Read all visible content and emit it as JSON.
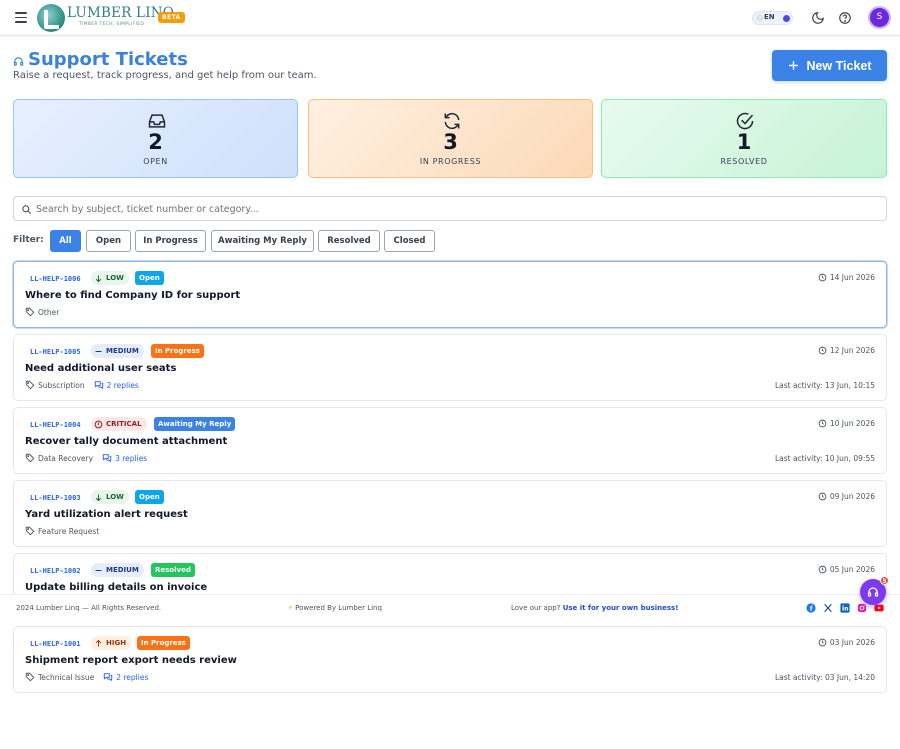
{
  "app": {
    "logo_text": "LUMBER LINQ",
    "logo_tagline": "TIMBER TECH, SIMPLIFIED",
    "beta_label": "BETA",
    "language": "EN",
    "avatar_initial": "S"
  },
  "header": {
    "title": "Support Tickets",
    "subtitle": "Raise a request, track progress, and get help from our team.",
    "new_ticket_label": "New Ticket"
  },
  "stats": [
    {
      "count": "2",
      "label": "OPEN",
      "icon": "inbox-icon",
      "color": "#3b82f6"
    },
    {
      "count": "3",
      "label": "IN PROGRESS",
      "icon": "refresh-icon",
      "color": "#f97316"
    },
    {
      "count": "1",
      "label": "RESOLVED",
      "icon": "check-circle-icon",
      "color": "#22c55e"
    }
  ],
  "search": {
    "placeholder": "Search by subject, ticket number or category..."
  },
  "filters": {
    "label": "Filter:",
    "options": [
      "All",
      "Open",
      "In Progress",
      "Awaiting My Reply",
      "Resolved",
      "Closed"
    ],
    "active": "All"
  },
  "tickets": [
    {
      "id": "LL-HELP-1006",
      "priority": "LOW",
      "status": "Open",
      "date": "14 Jun 2026",
      "subject": "Where to find Company ID for support",
      "category": "Other",
      "replies": "",
      "last_activity": ""
    },
    {
      "id": "LL-HELP-1005",
      "priority": "MEDIUM",
      "status": "In Progress",
      "date": "12 Jun 2026",
      "subject": "Need additional user seats",
      "category": "Subscription",
      "replies": "2 replies",
      "last_activity": "Last activity: 13 Jun, 10:15"
    },
    {
      "id": "LL-HELP-1004",
      "priority": "CRITICAL",
      "status": "Awaiting My Reply",
      "date": "10 Jun 2026",
      "subject": "Recover tally document attachment",
      "category": "Data Recovery",
      "replies": "3 replies",
      "last_activity": "Last activity: 10 Jun, 09:55"
    },
    {
      "id": "LL-HELP-1003",
      "priority": "LOW",
      "status": "Open",
      "date": "09 Jun 2026",
      "subject": "Yard utilization alert request",
      "category": "Feature Request",
      "replies": "",
      "last_activity": ""
    },
    {
      "id": "LL-HELP-1002",
      "priority": "MEDIUM",
      "status": "Resolved",
      "date": "05 Jun 2026",
      "subject": "Update billing details on invoice",
      "category": "",
      "replies": "",
      "last_activity": ""
    },
    {
      "id": "LL-HELP-1001",
      "priority": "HIGH",
      "status": "In Progress",
      "date": "03 Jun 2026",
      "subject": "Shipment report export needs review",
      "category": "Technical Issue",
      "replies": "2 replies",
      "last_activity": "Last activity: 03 Jun, 14:20"
    }
  ],
  "footer": {
    "copyright": "2024 Lumber Linq — All Rights Reserved.",
    "powered": "Powered By Lumber Linq",
    "love_text": "Love our app?",
    "love_link": "Use it for your own business!",
    "social": [
      "facebook-icon",
      "x-icon",
      "linkedin-icon",
      "instagram-icon",
      "youtube-icon"
    ]
  },
  "help_fab": {
    "badge": "5"
  }
}
